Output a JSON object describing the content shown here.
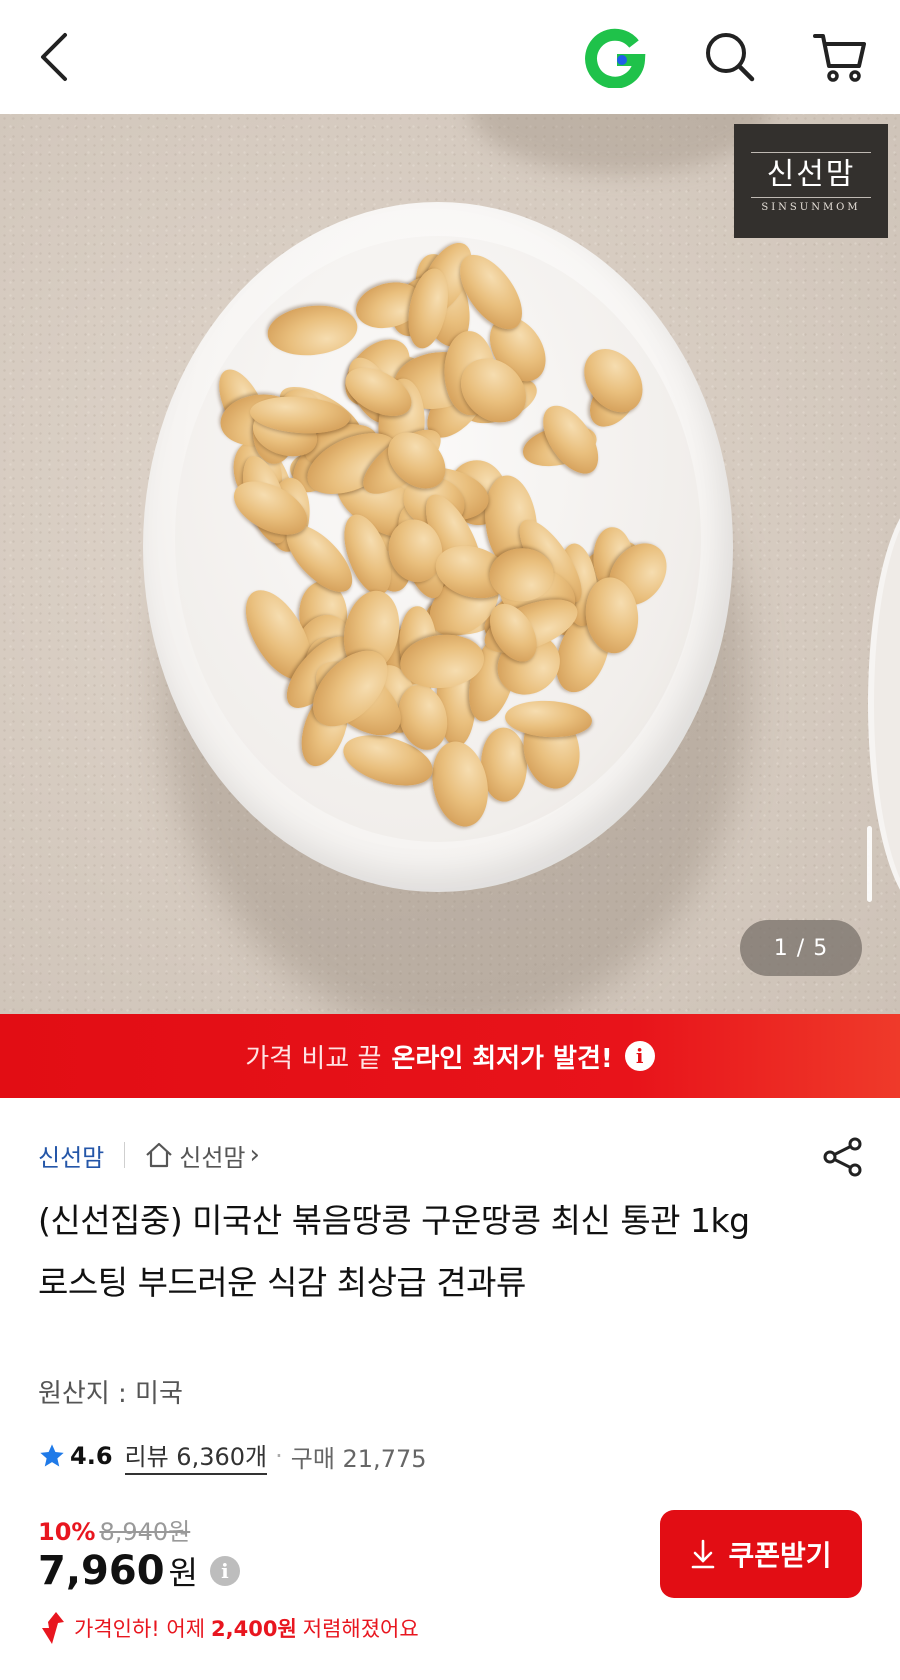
{
  "header": {
    "back_icon": "chevron-left-icon",
    "logo": "g-logo-icon",
    "search_icon": "search-icon",
    "cart_icon": "cart-icon"
  },
  "gallery": {
    "brand_name": "신선맘",
    "brand_sub": "SINSUNMOM",
    "counter": "1 / 5"
  },
  "banner": {
    "text_light": "가격 비교 끝",
    "text_bold": "온라인 최저가 발견!",
    "info_icon": "i"
  },
  "product": {
    "seller": "신선맘",
    "store_label": "신선맘",
    "store_chevron": "›",
    "title": "(신선집중) 미국산 볶음땅콩 구운땅콩 최신 통관 1kg 로스팅 부드러운 식감 최상급 견과류",
    "origin": "원산지 : 미국",
    "rating": "4.6",
    "review_label": "리뷰 6,360개",
    "dot": "·",
    "purchases": "구매 21,775",
    "discount": "10%",
    "original_price": "8,940원",
    "price": "7,960",
    "currency": "원",
    "price_info": "i",
    "drop_prefix": "가격인하! 어제",
    "drop_amount": "2,400원",
    "drop_suffix": "저렴해졌어요",
    "coupon_label": "쿠폰받기"
  },
  "colors": {
    "accent_red": "#e20d14",
    "seller_blue": "#2456a8",
    "star_blue": "#1f7ae8",
    "g_logo_green": "#1fc24a"
  }
}
